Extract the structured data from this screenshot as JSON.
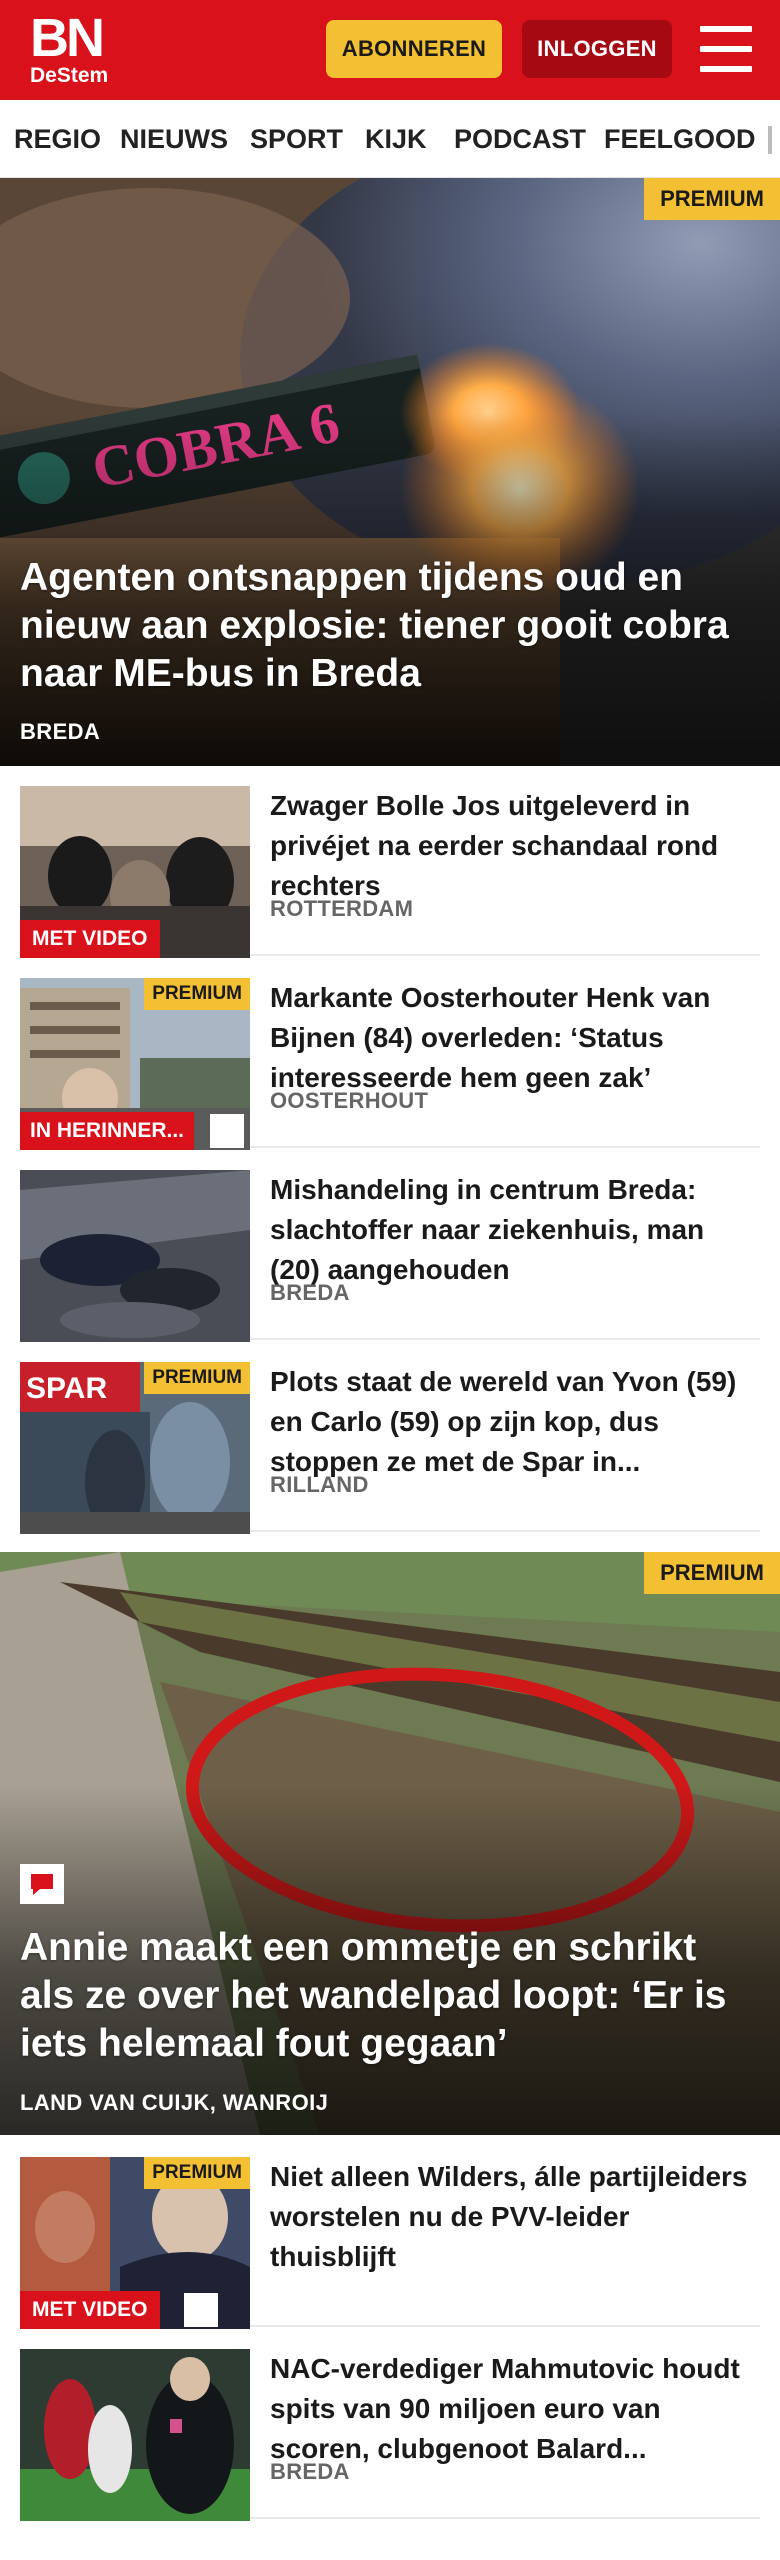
{
  "header": {
    "logo_top": "BN",
    "logo_bottom": "DeStem",
    "subscribe_label": "ABONNEREN",
    "login_label": "INLOGGEN",
    "menu_icon": "hamburger-menu-icon"
  },
  "nav": {
    "items": [
      "REGIO",
      "NIEUWS",
      "SPORT",
      "KIJK",
      "PODCAST",
      "FEELGOOD"
    ]
  },
  "hero_top": {
    "premium": "PREMIUM",
    "title": "Agenten ontsnappen tijdens oud en nieuw aan explosie: tiener gooit cobra naar ME-bus in Breda",
    "location": "BREDA",
    "image_text": "COBRA 6"
  },
  "list_top": [
    {
      "title": "Zwager Bolle Jos uitgeleverd in privéjet na eerder schandaal rond rechters",
      "location": "ROTTERDAM",
      "video": "MET VIDEO"
    },
    {
      "title": "Markante Oosterhouter Henk van Bijnen (84) overleden: ‘Status interesseerde hem geen zak’",
      "location": "OOSTERHOUT",
      "premium": "PREMIUM",
      "label": "IN HERINNER...",
      "comment_icon": "comment-icon"
    },
    {
      "title": "Mishandeling in centrum Breda: slachtoffer naar ziekenhuis, man (20) aangehouden",
      "location": "BREDA"
    },
    {
      "title": "Plots staat de wereld van Yvon (59) en Carlo (59) op zijn kop, dus stoppen ze met de Spar in...",
      "location": "RILLAND",
      "premium": "PREMIUM",
      "image_text": "SPAR"
    }
  ],
  "hero_bottom": {
    "premium": "PREMIUM",
    "title": "Annie maakt een ommetje en schrikt als ze over het wandelpad loopt: ‘Er is iets helemaal fout gegaan’",
    "location": "LAND VAN CUIJK, WANROIJ",
    "comment_icon": "comment-icon"
  },
  "list_bottom": [
    {
      "title": "Niet alleen Wilders, álle partijlei­ders worstelen nu de PVV-leider thuisblijft",
      "premium": "PREMIUM",
      "video": "MET VIDEO",
      "comment_icon": "comment-icon"
    },
    {
      "title": "NAC-verdediger Mahmutovic houdt spits van 90 miljoen euro van scoren, clubgenoot Balard...",
      "location": "BREDA"
    }
  ],
  "colors": {
    "brand_red": "#d9111b",
    "premium_yellow": "#f3bf33",
    "login_dark_red": "#a50a12"
  }
}
